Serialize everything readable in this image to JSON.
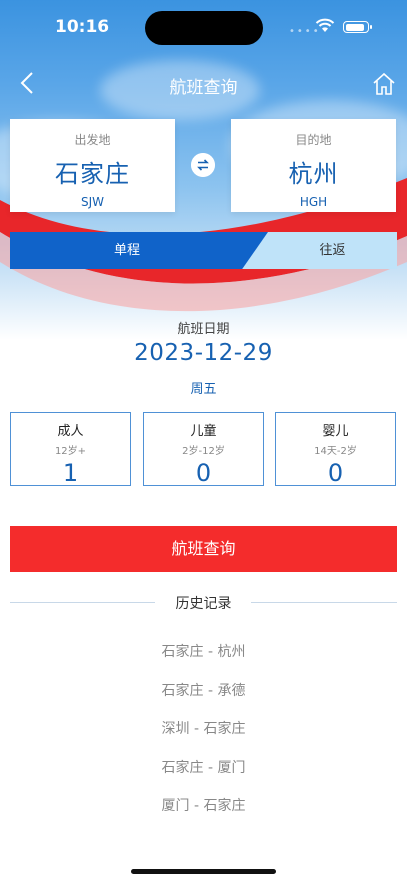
{
  "status_bar": {
    "time": "10:16"
  },
  "nav": {
    "title": "航班查询",
    "back_icon": "chevron-left-icon",
    "home_icon": "home-icon"
  },
  "route": {
    "from": {
      "label": "出发地",
      "city": "石家庄",
      "code": "SJW"
    },
    "to": {
      "label": "目的地",
      "city": "杭州",
      "code": "HGH"
    },
    "swap_icon": "swap-arrows-icon"
  },
  "trip_type": {
    "one_way": "单程",
    "round_trip": "往返",
    "selected": "单程"
  },
  "date": {
    "label": "航班日期",
    "value": "2023-12-29",
    "weekday": "周五"
  },
  "passengers": [
    {
      "type": "成人",
      "range": "12岁+",
      "count": "1"
    },
    {
      "type": "儿童",
      "range": "2岁-12岁",
      "count": "0"
    },
    {
      "type": "婴儿",
      "range": "14天-2岁",
      "count": "0"
    }
  ],
  "search_button": "航班查询",
  "history": {
    "title": "历史记录",
    "items": [
      "石家庄 - 杭州",
      "石家庄 - 承德",
      "深圳 - 石家庄",
      "石家庄 - 厦门",
      "厦门 - 石家庄"
    ]
  },
  "colors": {
    "primary_blue": "#1761b1",
    "tab_blue": "#1063c9",
    "search_red": "#f42c2c",
    "swoosh_red": "#e8262a"
  }
}
